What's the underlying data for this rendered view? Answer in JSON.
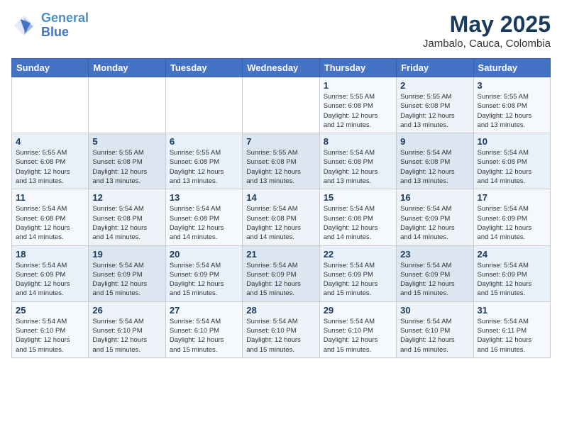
{
  "header": {
    "logo_line1": "General",
    "logo_line2": "Blue",
    "month": "May 2025",
    "location": "Jambalo, Cauca, Colombia"
  },
  "weekdays": [
    "Sunday",
    "Monday",
    "Tuesday",
    "Wednesday",
    "Thursday",
    "Friday",
    "Saturday"
  ],
  "weeks": [
    [
      {
        "day": "",
        "info": ""
      },
      {
        "day": "",
        "info": ""
      },
      {
        "day": "",
        "info": ""
      },
      {
        "day": "",
        "info": ""
      },
      {
        "day": "1",
        "info": "Sunrise: 5:55 AM\nSunset: 6:08 PM\nDaylight: 12 hours\nand 12 minutes."
      },
      {
        "day": "2",
        "info": "Sunrise: 5:55 AM\nSunset: 6:08 PM\nDaylight: 12 hours\nand 13 minutes."
      },
      {
        "day": "3",
        "info": "Sunrise: 5:55 AM\nSunset: 6:08 PM\nDaylight: 12 hours\nand 13 minutes."
      }
    ],
    [
      {
        "day": "4",
        "info": "Sunrise: 5:55 AM\nSunset: 6:08 PM\nDaylight: 12 hours\nand 13 minutes."
      },
      {
        "day": "5",
        "info": "Sunrise: 5:55 AM\nSunset: 6:08 PM\nDaylight: 12 hours\nand 13 minutes."
      },
      {
        "day": "6",
        "info": "Sunrise: 5:55 AM\nSunset: 6:08 PM\nDaylight: 12 hours\nand 13 minutes."
      },
      {
        "day": "7",
        "info": "Sunrise: 5:55 AM\nSunset: 6:08 PM\nDaylight: 12 hours\nand 13 minutes."
      },
      {
        "day": "8",
        "info": "Sunrise: 5:54 AM\nSunset: 6:08 PM\nDaylight: 12 hours\nand 13 minutes."
      },
      {
        "day": "9",
        "info": "Sunrise: 5:54 AM\nSunset: 6:08 PM\nDaylight: 12 hours\nand 13 minutes."
      },
      {
        "day": "10",
        "info": "Sunrise: 5:54 AM\nSunset: 6:08 PM\nDaylight: 12 hours\nand 14 minutes."
      }
    ],
    [
      {
        "day": "11",
        "info": "Sunrise: 5:54 AM\nSunset: 6:08 PM\nDaylight: 12 hours\nand 14 minutes."
      },
      {
        "day": "12",
        "info": "Sunrise: 5:54 AM\nSunset: 6:08 PM\nDaylight: 12 hours\nand 14 minutes."
      },
      {
        "day": "13",
        "info": "Sunrise: 5:54 AM\nSunset: 6:08 PM\nDaylight: 12 hours\nand 14 minutes."
      },
      {
        "day": "14",
        "info": "Sunrise: 5:54 AM\nSunset: 6:08 PM\nDaylight: 12 hours\nand 14 minutes."
      },
      {
        "day": "15",
        "info": "Sunrise: 5:54 AM\nSunset: 6:08 PM\nDaylight: 12 hours\nand 14 minutes."
      },
      {
        "day": "16",
        "info": "Sunrise: 5:54 AM\nSunset: 6:09 PM\nDaylight: 12 hours\nand 14 minutes."
      },
      {
        "day": "17",
        "info": "Sunrise: 5:54 AM\nSunset: 6:09 PM\nDaylight: 12 hours\nand 14 minutes."
      }
    ],
    [
      {
        "day": "18",
        "info": "Sunrise: 5:54 AM\nSunset: 6:09 PM\nDaylight: 12 hours\nand 14 minutes."
      },
      {
        "day": "19",
        "info": "Sunrise: 5:54 AM\nSunset: 6:09 PM\nDaylight: 12 hours\nand 15 minutes."
      },
      {
        "day": "20",
        "info": "Sunrise: 5:54 AM\nSunset: 6:09 PM\nDaylight: 12 hours\nand 15 minutes."
      },
      {
        "day": "21",
        "info": "Sunrise: 5:54 AM\nSunset: 6:09 PM\nDaylight: 12 hours\nand 15 minutes."
      },
      {
        "day": "22",
        "info": "Sunrise: 5:54 AM\nSunset: 6:09 PM\nDaylight: 12 hours\nand 15 minutes."
      },
      {
        "day": "23",
        "info": "Sunrise: 5:54 AM\nSunset: 6:09 PM\nDaylight: 12 hours\nand 15 minutes."
      },
      {
        "day": "24",
        "info": "Sunrise: 5:54 AM\nSunset: 6:09 PM\nDaylight: 12 hours\nand 15 minutes."
      }
    ],
    [
      {
        "day": "25",
        "info": "Sunrise: 5:54 AM\nSunset: 6:10 PM\nDaylight: 12 hours\nand 15 minutes."
      },
      {
        "day": "26",
        "info": "Sunrise: 5:54 AM\nSunset: 6:10 PM\nDaylight: 12 hours\nand 15 minutes."
      },
      {
        "day": "27",
        "info": "Sunrise: 5:54 AM\nSunset: 6:10 PM\nDaylight: 12 hours\nand 15 minutes."
      },
      {
        "day": "28",
        "info": "Sunrise: 5:54 AM\nSunset: 6:10 PM\nDaylight: 12 hours\nand 15 minutes."
      },
      {
        "day": "29",
        "info": "Sunrise: 5:54 AM\nSunset: 6:10 PM\nDaylight: 12 hours\nand 15 minutes."
      },
      {
        "day": "30",
        "info": "Sunrise: 5:54 AM\nSunset: 6:10 PM\nDaylight: 12 hours\nand 16 minutes."
      },
      {
        "day": "31",
        "info": "Sunrise: 5:54 AM\nSunset: 6:11 PM\nDaylight: 12 hours\nand 16 minutes."
      }
    ]
  ]
}
